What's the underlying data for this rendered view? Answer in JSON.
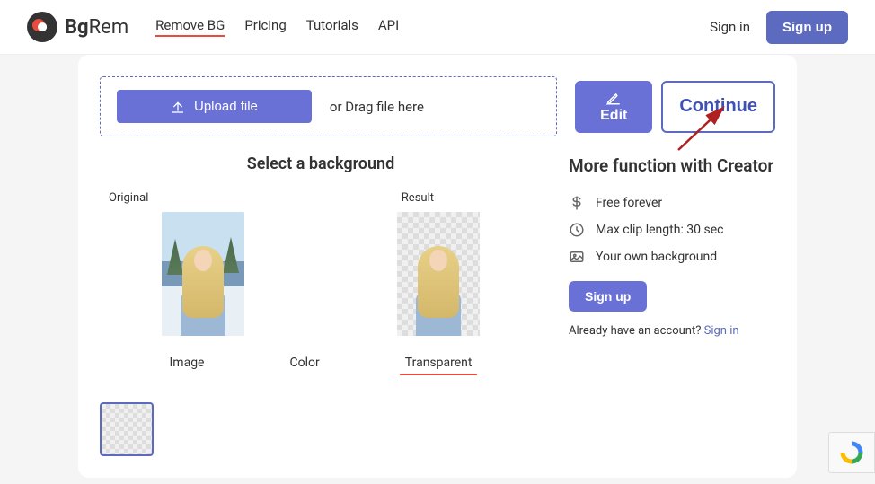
{
  "brand": {
    "name_bold": "Bg",
    "name_light": "Rem"
  },
  "nav": {
    "items": [
      {
        "label": "Remove BG",
        "active": true
      },
      {
        "label": "Pricing",
        "active": false
      },
      {
        "label": "Tutorials",
        "active": false
      },
      {
        "label": "API",
        "active": false
      }
    ]
  },
  "header": {
    "signin": "Sign in",
    "signup": "Sign up"
  },
  "upload": {
    "button": "Upload file",
    "drag": "or Drag file here"
  },
  "actions": {
    "edit": "Edit",
    "continue": "Continue"
  },
  "select": {
    "title": "Select a background",
    "labels": {
      "original": "Original",
      "result": "Result"
    },
    "tabs": [
      {
        "label": "Image",
        "active": false
      },
      {
        "label": "Color",
        "active": false
      },
      {
        "label": "Transparent",
        "active": true
      }
    ]
  },
  "creator": {
    "title": "More function with Creator",
    "features": [
      {
        "icon": "dollar",
        "text": "Free forever"
      },
      {
        "icon": "clock",
        "text": "Max clip length: 30 sec"
      },
      {
        "icon": "image",
        "text": "Your own background"
      }
    ],
    "signup": "Sign up",
    "already": "Already have an account? ",
    "signin_link": "Sign in"
  }
}
